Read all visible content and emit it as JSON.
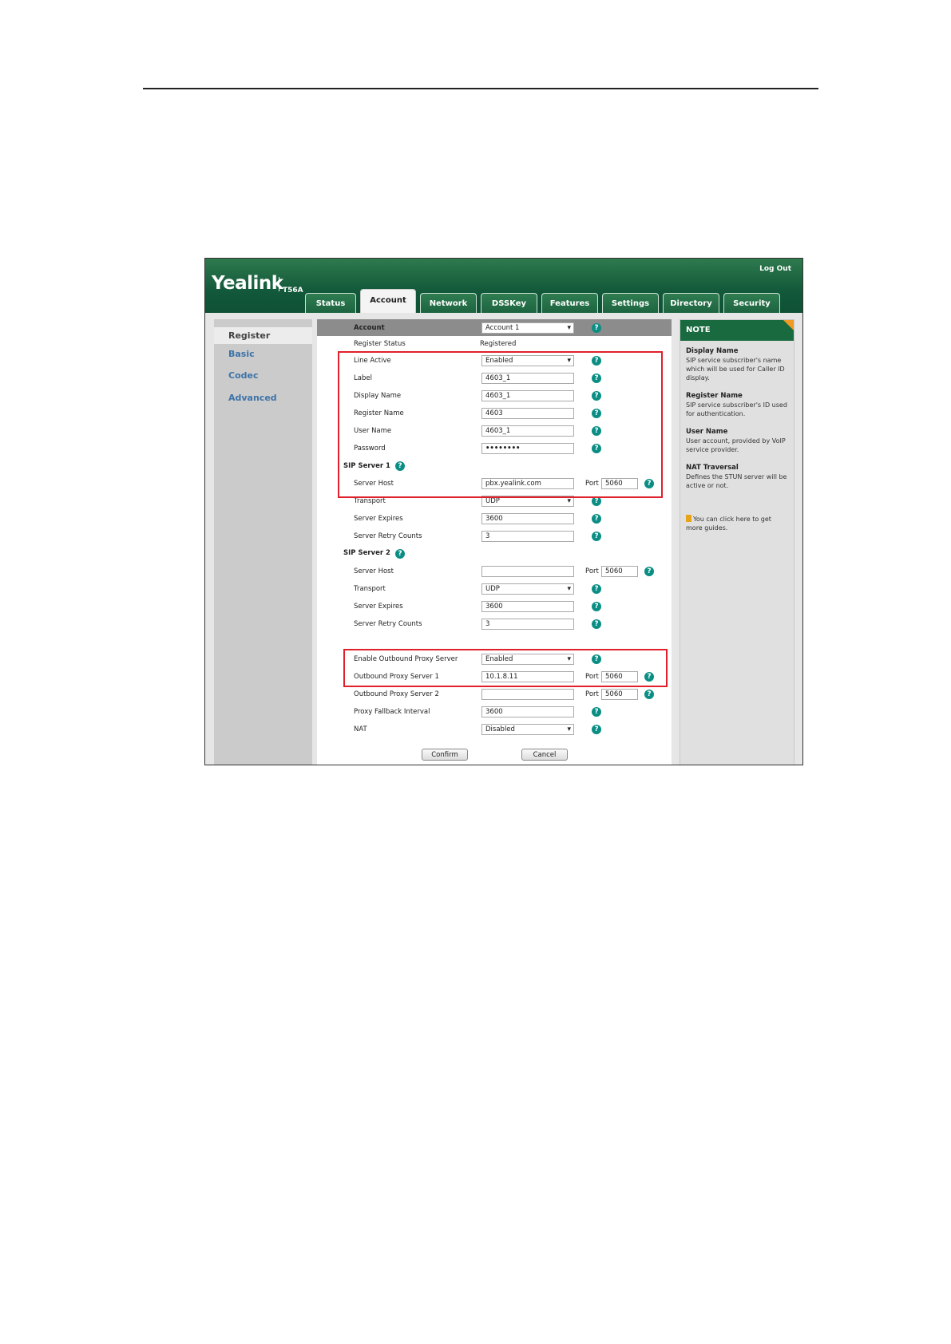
{
  "header": {
    "logout": "Log Out",
    "logo": "Yealink",
    "model": "T56A"
  },
  "tabs": [
    "Status",
    "Account",
    "Network",
    "DSSKey",
    "Features",
    "Settings",
    "Directory",
    "Security"
  ],
  "sidebar": {
    "items": [
      "Register",
      "Basic",
      "Codec",
      "Advanced"
    ]
  },
  "account": {
    "label": "Account",
    "value": "Account 1"
  },
  "register_status": {
    "label": "Register Status",
    "value": "Registered"
  },
  "fields": [
    {
      "label": "Line Active",
      "value": "Enabled"
    },
    {
      "label": "Label",
      "value": "4603_1"
    },
    {
      "label": "Display Name",
      "value": "4603_1"
    },
    {
      "label": "Register Name",
      "value": "4603"
    },
    {
      "label": "User Name",
      "value": "4603_1"
    },
    {
      "label": "Password",
      "value": "••••••••"
    }
  ],
  "sip1": {
    "title": "SIP Server 1",
    "server_host_label": "Server Host",
    "server_host": "pbx.yealink.com",
    "port_label": "Port",
    "port": "5060",
    "transport_label": "Transport",
    "transport": "UDP",
    "expires_label": "Server Expires",
    "expires": "3600",
    "retry_label": "Server Retry Counts",
    "retry": "3"
  },
  "sip2": {
    "title": "SIP Server 2",
    "server_host_label": "Server Host",
    "server_host": "",
    "port_label": "Port",
    "port": "5060",
    "transport_label": "Transport",
    "transport": "UDP",
    "expires_label": "Server Expires",
    "expires": "3600",
    "retry_label": "Server Retry Counts",
    "retry": "3"
  },
  "proxy": {
    "enable_label": "Enable Outbound Proxy Server",
    "enable": "Enabled",
    "server1_label": "Outbound Proxy Server 1",
    "server1": "10.1.8.11",
    "port1": "5060",
    "server2_label": "Outbound Proxy Server 2",
    "server2": "",
    "port2": "5060",
    "fallback_label": "Proxy Fallback Interval",
    "fallback": "3600",
    "nat_label": "NAT",
    "nat": "Disabled"
  },
  "buttons": {
    "confirm": "Confirm",
    "cancel": "Cancel"
  },
  "note": {
    "title": "NOTE",
    "sections": [
      {
        "title": "Display Name",
        "text": "SIP service subscriber's name which will be used for Caller ID display."
      },
      {
        "title": "Register Name",
        "text": "SIP service subscriber's ID used for authentication."
      },
      {
        "title": "User Name",
        "text": "User account, provided by VoIP service provider."
      },
      {
        "title": "NAT Traversal",
        "text": "Defines the STUN server will be active or not."
      }
    ],
    "guide": "You can click here to get more guides."
  },
  "colors": {
    "header_green": "#12583a",
    "highlight_red": "#e0202a",
    "help_teal": "#0a8e84",
    "note_accent": "#f09b23"
  }
}
